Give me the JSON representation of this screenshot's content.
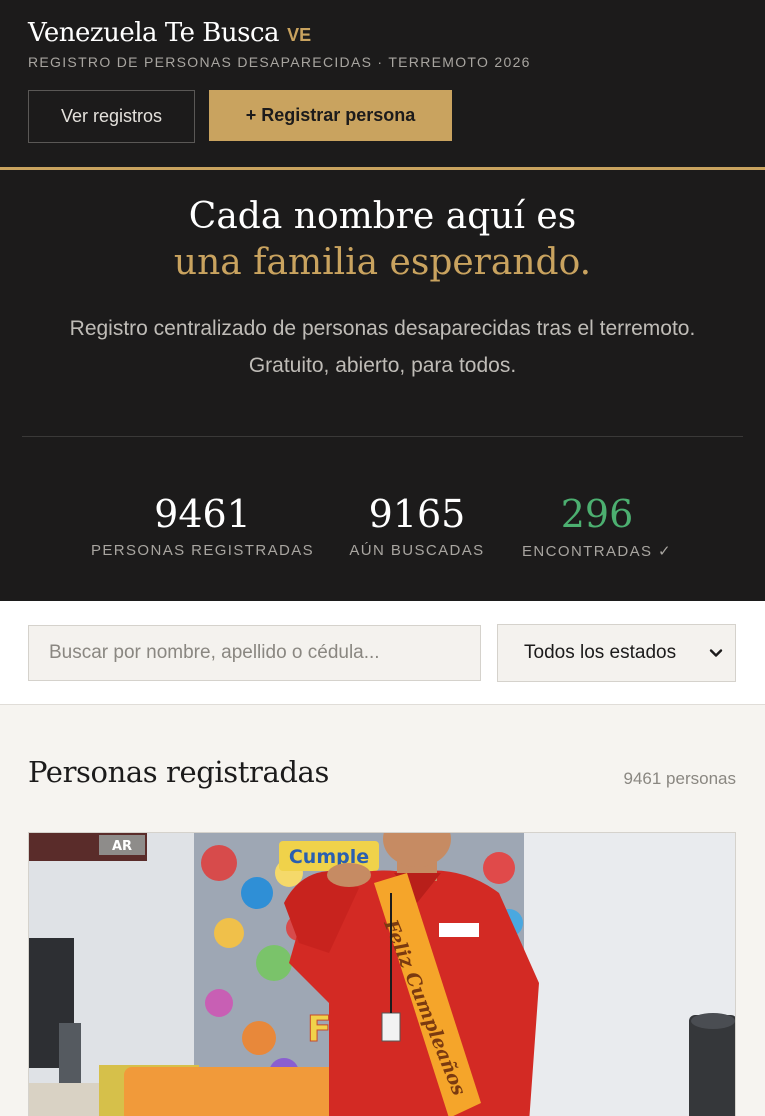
{
  "header": {
    "title": "Venezuela Te Busca",
    "country_code": "VE",
    "subtitle": "REGISTRO DE PERSONAS DESAPARECIDAS · TERREMOTO 2026",
    "view_button": "Ver registros",
    "register_button": "+ Registrar persona"
  },
  "hero": {
    "line1": "Cada nombre aquí es",
    "line2": "una familia esperando.",
    "desc1": "Registro centralizado de personas desaparecidas tras el terremoto.",
    "desc2": "Gratuito, abierto, para todos."
  },
  "stats": [
    {
      "value": "9461",
      "label": "PERSONAS REGISTRADAS"
    },
    {
      "value": "9165",
      "label": "AÚN BUSCADAS"
    },
    {
      "value": "296",
      "label": "ENCONTRADAS ✓"
    }
  ],
  "search": {
    "placeholder": "Buscar por nombre, apellido o cédula...",
    "filter_selected": "Todos los estados"
  },
  "list": {
    "title": "Personas registradas",
    "count": "9461 personas"
  },
  "card_photo": {
    "banner_text": "Cumple",
    "sash_text": "Feliz Cumpleaños",
    "sign_text": "AR",
    "letter_text": "Fe"
  },
  "colors": {
    "dark_bg": "#1c1b1b",
    "gold": "#c9a35f",
    "green": "#4caf70",
    "light_bg": "#f6f4f0"
  }
}
